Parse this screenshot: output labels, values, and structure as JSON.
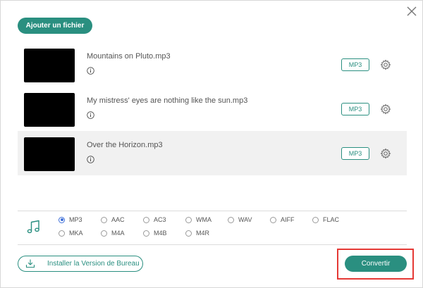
{
  "header": {
    "add_file_label": "Ajouter un fichier",
    "close_icon": "close-icon"
  },
  "files": [
    {
      "name": "Mountains on Pluto.mp3",
      "format": "MP3"
    },
    {
      "name": "My mistress' eyes are nothing like the sun.mp3",
      "format": "MP3"
    },
    {
      "name": "Over the Horizon.mp3",
      "format": "MP3"
    }
  ],
  "formats": {
    "selected": "MP3",
    "row1": [
      "MP3",
      "AAC",
      "AC3",
      "WMA",
      "WAV",
      "AIFF",
      "FLAC"
    ],
    "row2": [
      "MKA",
      "M4A",
      "M4B",
      "M4R"
    ]
  },
  "footer": {
    "install_label": "Installer la Version de Bureau",
    "convert_label": "Convertir"
  },
  "colors": {
    "accent": "#2a8f80",
    "highlight": "#e53935",
    "radio_selected": "#3e6fd8"
  }
}
